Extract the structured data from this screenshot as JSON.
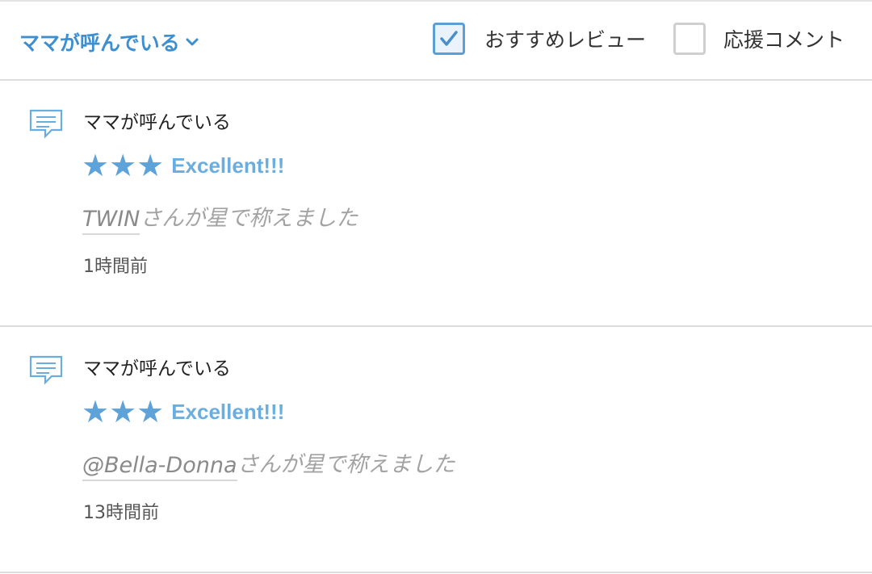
{
  "header": {
    "story_selector": "ママが呼んでいる",
    "filters": [
      {
        "label": "おすすめレビュー",
        "checked": true
      },
      {
        "label": "応援コメント",
        "checked": false
      }
    ]
  },
  "reviews": [
    {
      "title": "ママが呼んでいる",
      "stars": "★★★",
      "rating_label": "Excellent!!!",
      "user": "TWIN",
      "praise_suffix": "さんが星で称えました",
      "time": "1時間前"
    },
    {
      "title": "ママが呼んでいる",
      "stars": "★★★",
      "rating_label": "Excellent!!!",
      "user": "@Bella-Donna",
      "praise_suffix": "さんが星で称えました",
      "time": "13時間前"
    }
  ],
  "icons": {
    "comment": "comment-icon",
    "chevron": "chevron-down-icon",
    "check": "check-icon"
  },
  "colors": {
    "accent": "#3d8fd0",
    "star": "#5da3d9",
    "muted_text": "#a3a3a3"
  }
}
